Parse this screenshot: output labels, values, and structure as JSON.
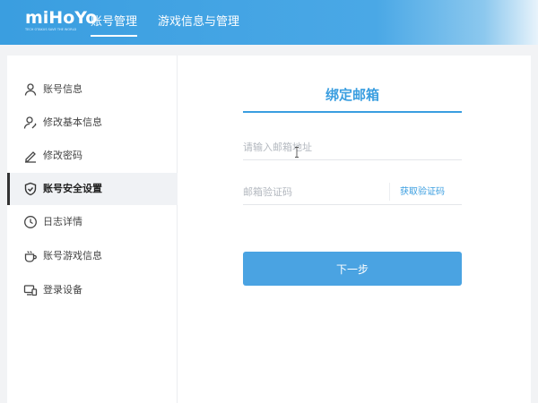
{
  "header": {
    "logo_text": "miHoYo",
    "logo_subtitle": "TECH OTAKUS SAVE THE WORLD",
    "tabs": [
      {
        "label": "账号管理",
        "active": true
      },
      {
        "label": "游戏信息与管理",
        "active": false
      }
    ]
  },
  "sidebar": {
    "items": [
      {
        "label": "账号信息",
        "icon": "user-icon",
        "active": false
      },
      {
        "label": "修改基本信息",
        "icon": "user-edit-icon",
        "active": false
      },
      {
        "label": "修改密码",
        "icon": "pencil-icon",
        "active": false
      },
      {
        "label": "账号安全设置",
        "icon": "shield-check-icon",
        "active": true
      },
      {
        "label": "日志详情",
        "icon": "clock-icon",
        "active": false
      },
      {
        "label": "账号游戏信息",
        "icon": "cup-icon",
        "active": false
      },
      {
        "label": "登录设备",
        "icon": "devices-icon",
        "active": false
      }
    ]
  },
  "form": {
    "title": "绑定邮箱",
    "email_placeholder": "请输入邮箱地址",
    "code_placeholder": "邮箱验证码",
    "get_code_label": "获取验证码",
    "next_label": "下一步"
  },
  "colors": {
    "accent": "#3a9ee0",
    "button": "#4aa3e2",
    "placeholder": "#b3b8bf"
  }
}
